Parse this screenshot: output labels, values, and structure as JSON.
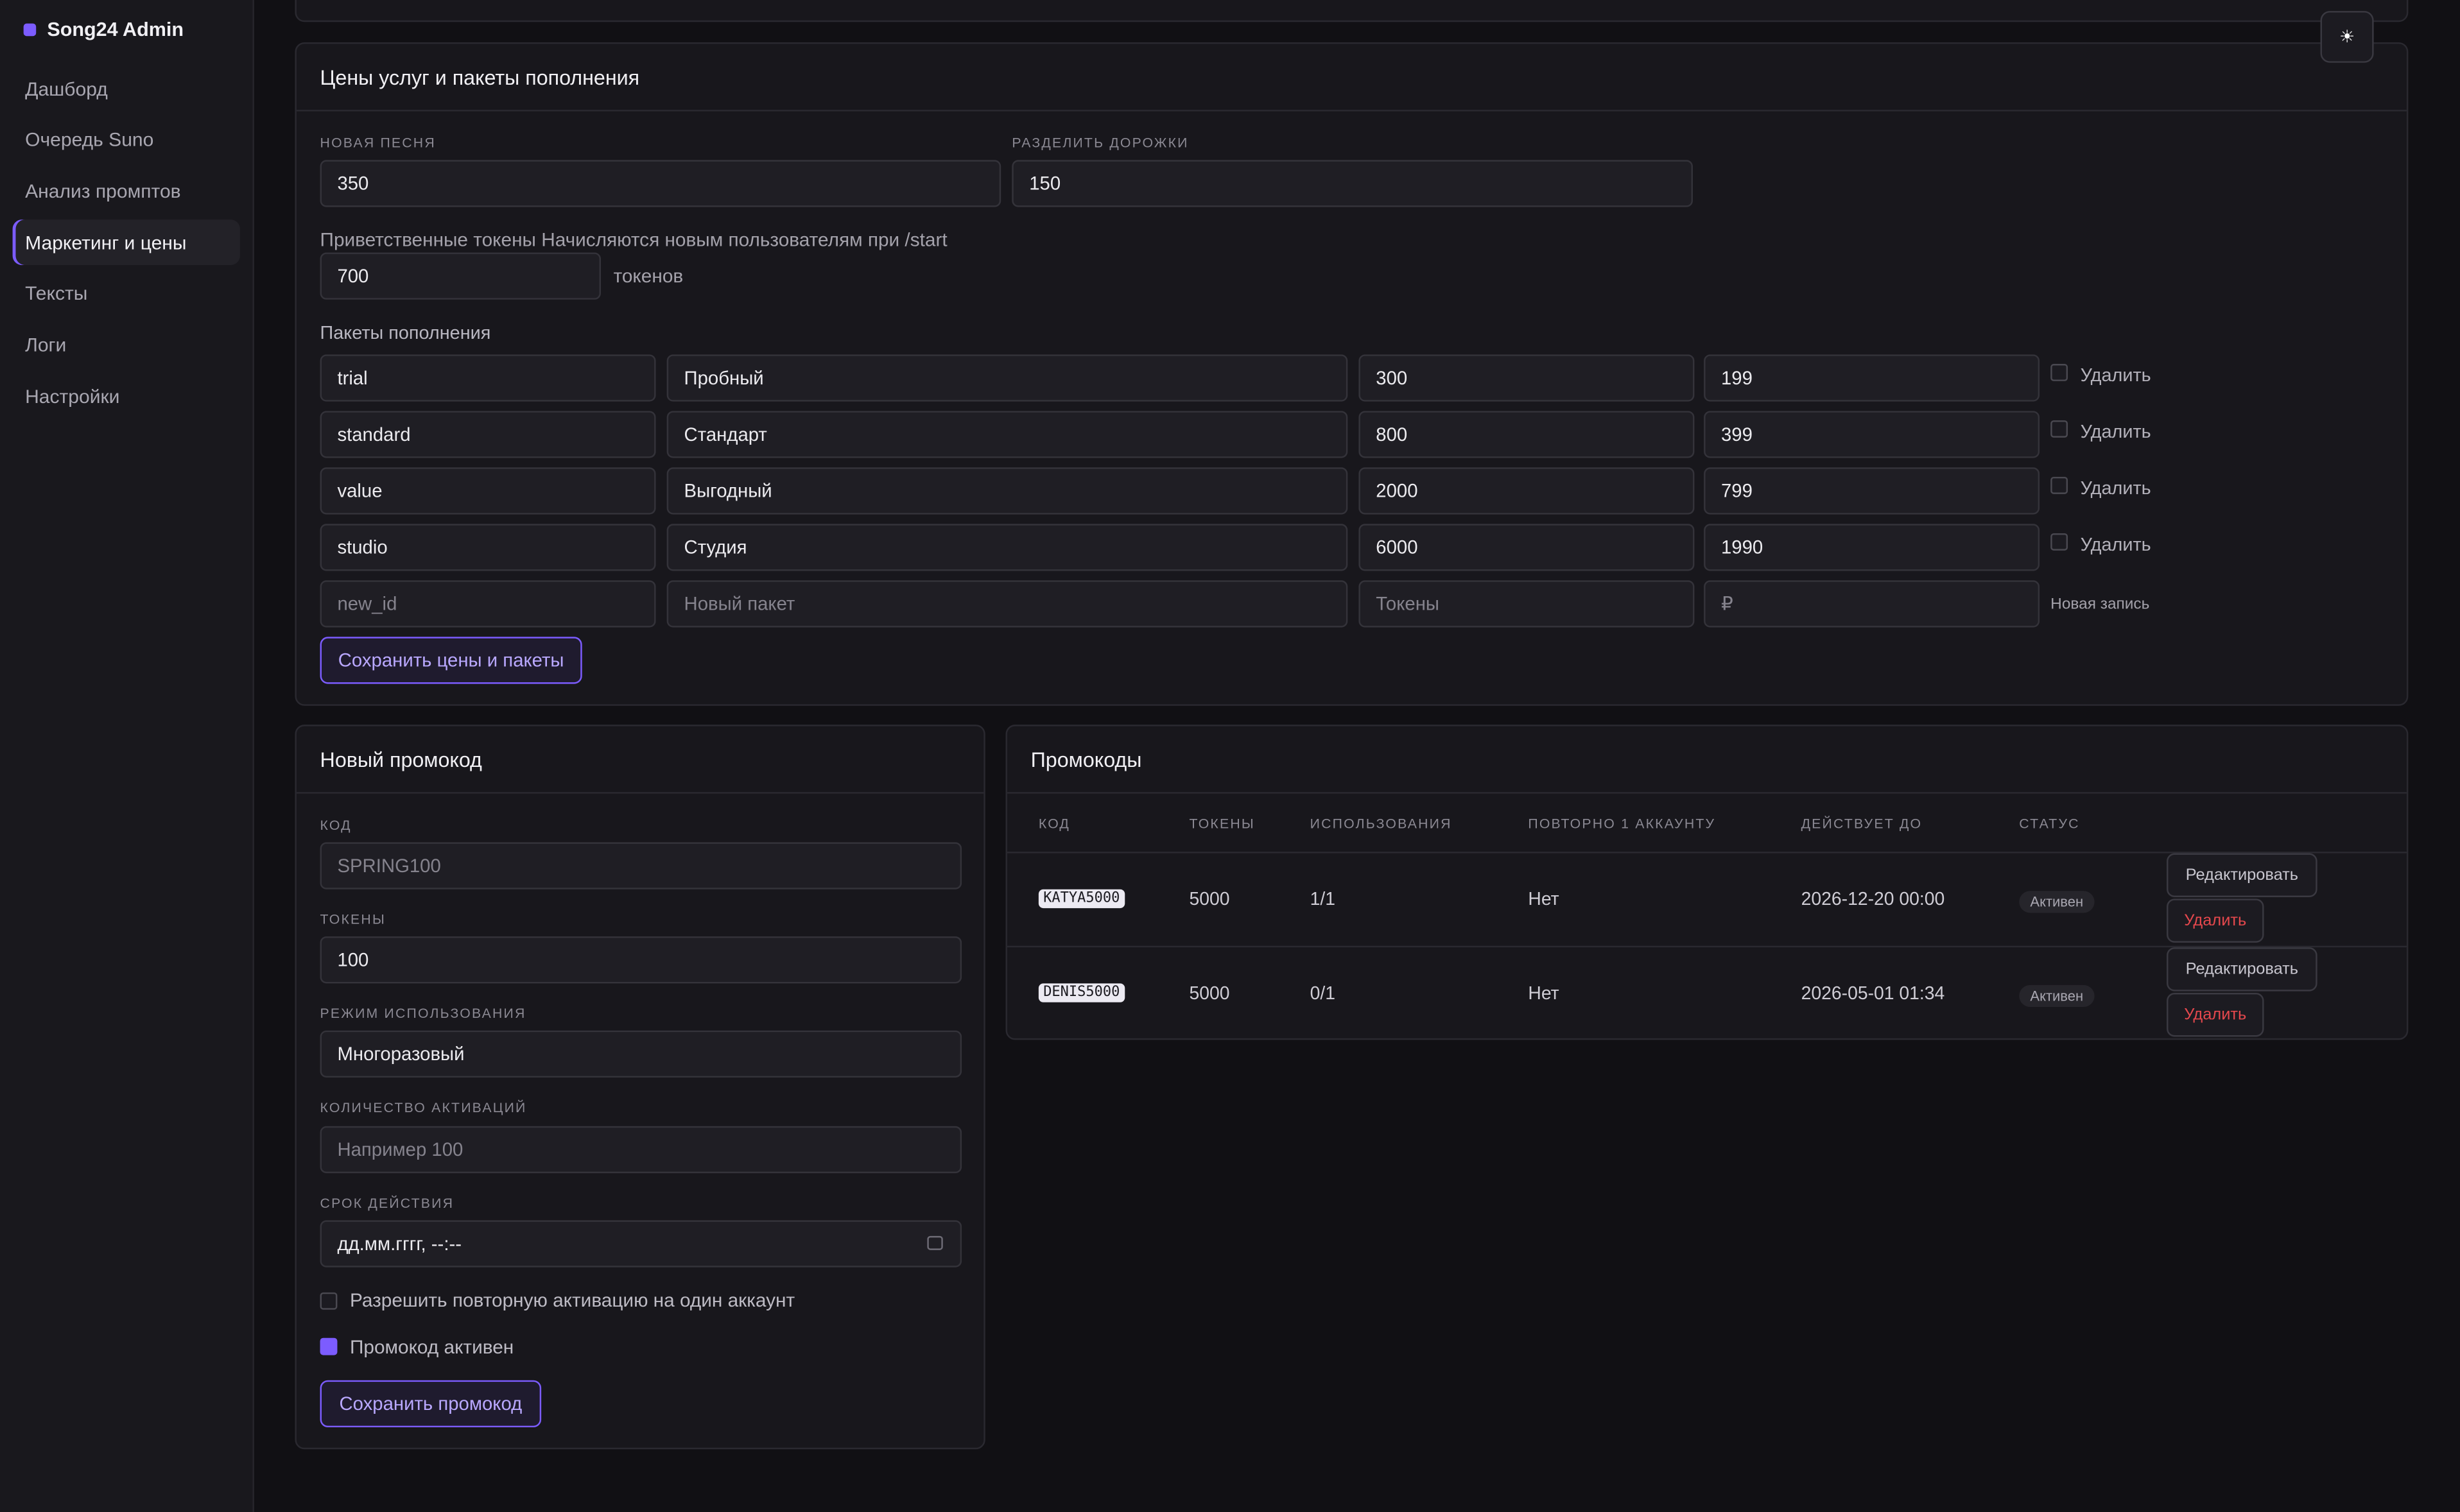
{
  "app": {
    "title": "Song24 Admin"
  },
  "sidebar": {
    "items": [
      {
        "label": "Дашборд"
      },
      {
        "label": "Очередь Suno"
      },
      {
        "label": "Анализ промптов"
      },
      {
        "label": "Маркетинг и цены",
        "active": true
      },
      {
        "label": "Тексты"
      },
      {
        "label": "Логи"
      },
      {
        "label": "Настройки"
      }
    ]
  },
  "theme_toggle": {
    "icon": "sun-icon",
    "glyph": "☀"
  },
  "pricing": {
    "title": "Цены услуг и пакеты пополнения",
    "new_song": {
      "label": "Новая песня",
      "value": "350"
    },
    "split_tracks": {
      "label": "Разделить дорожки",
      "value": "150"
    },
    "welcome": {
      "label": "Приветственные токены Начисляются новым пользователям при /start",
      "value": "700",
      "unit": "токенов"
    },
    "packages_title": "Пакеты пополнения",
    "packages": [
      {
        "id": "trial",
        "name": "Пробный",
        "tokens": "300",
        "price": "199",
        "delete": "Удалить"
      },
      {
        "id": "standard",
        "name": "Стандарт",
        "tokens": "800",
        "price": "399",
        "delete": "Удалить"
      },
      {
        "id": "value",
        "name": "Выгодный",
        "tokens": "2000",
        "price": "799",
        "delete": "Удалить"
      },
      {
        "id": "studio",
        "name": "Студия",
        "tokens": "6000",
        "price": "1990",
        "delete": "Удалить"
      }
    ],
    "new_package": {
      "id_placeholder": "new_id",
      "name_placeholder": "Новый пакет",
      "tokens_placeholder": "Токены",
      "price_placeholder": "₽",
      "note": "Новая запись"
    },
    "save_label": "Сохранить цены и пакеты"
  },
  "new_promo": {
    "title": "Новый промокод",
    "code": {
      "label": "Код",
      "placeholder": "SPRING100"
    },
    "tokens": {
      "label": "Токены",
      "value": "100"
    },
    "mode": {
      "label": "Режим использования",
      "value": "Многоразовый"
    },
    "activations": {
      "label": "Количество активаций",
      "placeholder": "Например 100"
    },
    "expiry": {
      "label": "Срок действия",
      "placeholder": "дд.мм.гггг, --:--"
    },
    "allow_repeat": {
      "label": "Разрешить повторную активацию на один аккаунт",
      "checked": false
    },
    "active": {
      "label": "Промокод активен",
      "checked": true
    },
    "save_label": "Сохранить промокод"
  },
  "promos": {
    "title": "Промокоды",
    "columns": [
      "Код",
      "Токены",
      "Использования",
      "Повторно 1 аккаунту",
      "Действует до",
      "Статус"
    ],
    "rows": [
      {
        "code": "KATYA5000",
        "tokens": "5000",
        "uses": "1/1",
        "repeat": "Нет",
        "until": "2026-12-20 00:00",
        "status": "Активен",
        "edit": "Редактировать",
        "delete": "Удалить"
      },
      {
        "code": "DENIS5000",
        "tokens": "5000",
        "uses": "0/1",
        "repeat": "Нет",
        "until": "2026-05-01 01:34",
        "status": "Активен",
        "edit": "Редактировать",
        "delete": "Удалить"
      }
    ]
  },
  "colors": {
    "accent": "#7c5cff",
    "danger": "#e5484d",
    "background": "#111014"
  }
}
